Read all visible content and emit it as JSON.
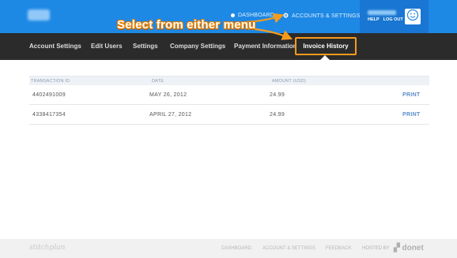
{
  "header": {
    "logo_text": "vitesi",
    "nav": [
      {
        "label": "DASHBOARD"
      },
      {
        "label": "ACCOUNTS & SETTINGS"
      }
    ],
    "user": {
      "name": "BEN CLAIRE",
      "help_label": "HELP",
      "logout_label": "LOG OUT",
      "avatar_icon": "smiley-face-icon"
    },
    "accent": "#1e88e5"
  },
  "annotation": {
    "text": "Select from either menu",
    "color": "#f59b1c"
  },
  "subnav": {
    "tabs": [
      {
        "label": "Account Settings"
      },
      {
        "label": "Edit Users"
      },
      {
        "label": "Settings"
      },
      {
        "label": "Company Settings"
      },
      {
        "label": "Payment Information"
      },
      {
        "label": "Invoice History",
        "active": true
      }
    ]
  },
  "invoices": {
    "columns": [
      "TRANSACTION ID",
      "DATE",
      "AMOUNT (USD)"
    ],
    "rows": [
      {
        "id": "4402491009",
        "date": "MAY 26, 2012",
        "amount": "24.99",
        "action": "PRINT"
      },
      {
        "id": "4338417354",
        "date": "APRIL 27, 2012",
        "amount": "24.99",
        "action": "PRINT"
      }
    ]
  },
  "footer": {
    "brand": "stitchplan",
    "links": [
      "DASHBOARD",
      "ACCOUNT & SETTINGS",
      "FEEDBACK"
    ],
    "hosted_by": "HOSTED BY",
    "host_name": "donet"
  }
}
